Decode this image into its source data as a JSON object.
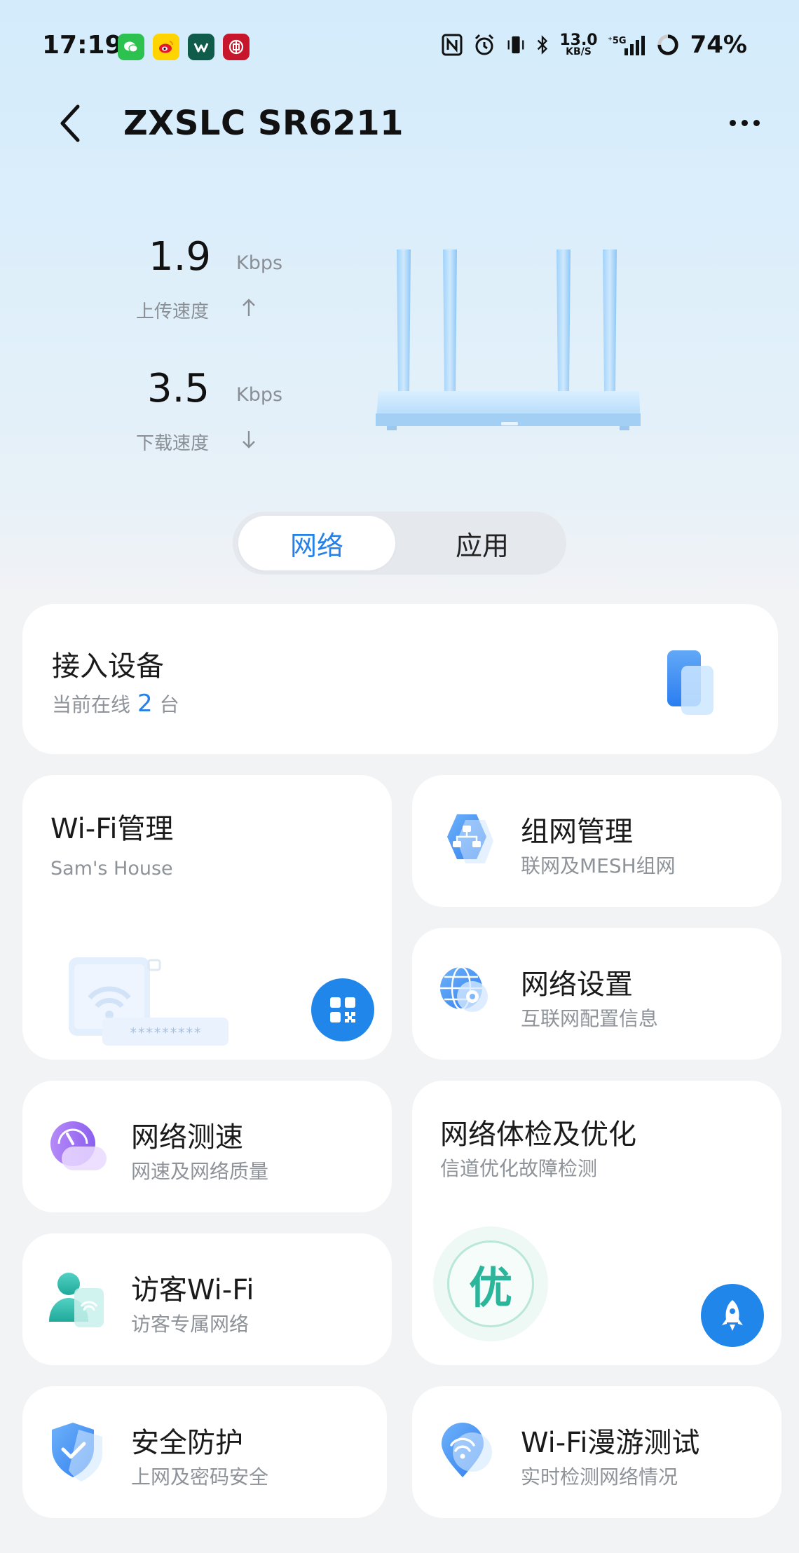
{
  "status_bar": {
    "time": "17:19",
    "apps": [
      "wechat-icon",
      "weibo-icon",
      "app-icon",
      "bank-icon"
    ],
    "net_speed_value": "13.0",
    "net_speed_unit": "KB/S",
    "network": "5G",
    "battery": "74%"
  },
  "header": {
    "title": "ZXSLC SR6211"
  },
  "speed": {
    "upload_value": "1.9",
    "upload_unit": "Kbps",
    "upload_label": "上传速度",
    "download_value": "3.5",
    "download_unit": "Kbps",
    "download_label": "下载速度"
  },
  "tabs": {
    "network": "网络",
    "apps": "应用",
    "active": "network"
  },
  "cards": {
    "devices": {
      "title": "接入设备",
      "sub_prefix": "当前在线",
      "count": "2",
      "sub_suffix": "台"
    },
    "wifi": {
      "title": "Wi-Fi管理",
      "ssid": "Sam's House",
      "password_mask": "*********"
    },
    "mesh": {
      "title": "组网管理",
      "sub": "联网及MESH组网"
    },
    "settings": {
      "title": "网络设置",
      "sub": "互联网配置信息"
    },
    "speedtest": {
      "title": "网络测速",
      "sub": "网速及网络质量"
    },
    "checkup": {
      "title": "网络体检及优化",
      "sub": "信道优化故障检测",
      "grade": "优"
    },
    "guest": {
      "title": "访客Wi-Fi",
      "sub": "访客专属网络"
    },
    "security": {
      "title": "安全防护",
      "sub": "上网及密码安全"
    },
    "roaming": {
      "title": "Wi-Fi漫游测试",
      "sub": "实时检测网络情况"
    }
  },
  "colors": {
    "accent": "#2581e8",
    "button_blue": "#2186ea",
    "grade_green": "#2bb59a"
  }
}
